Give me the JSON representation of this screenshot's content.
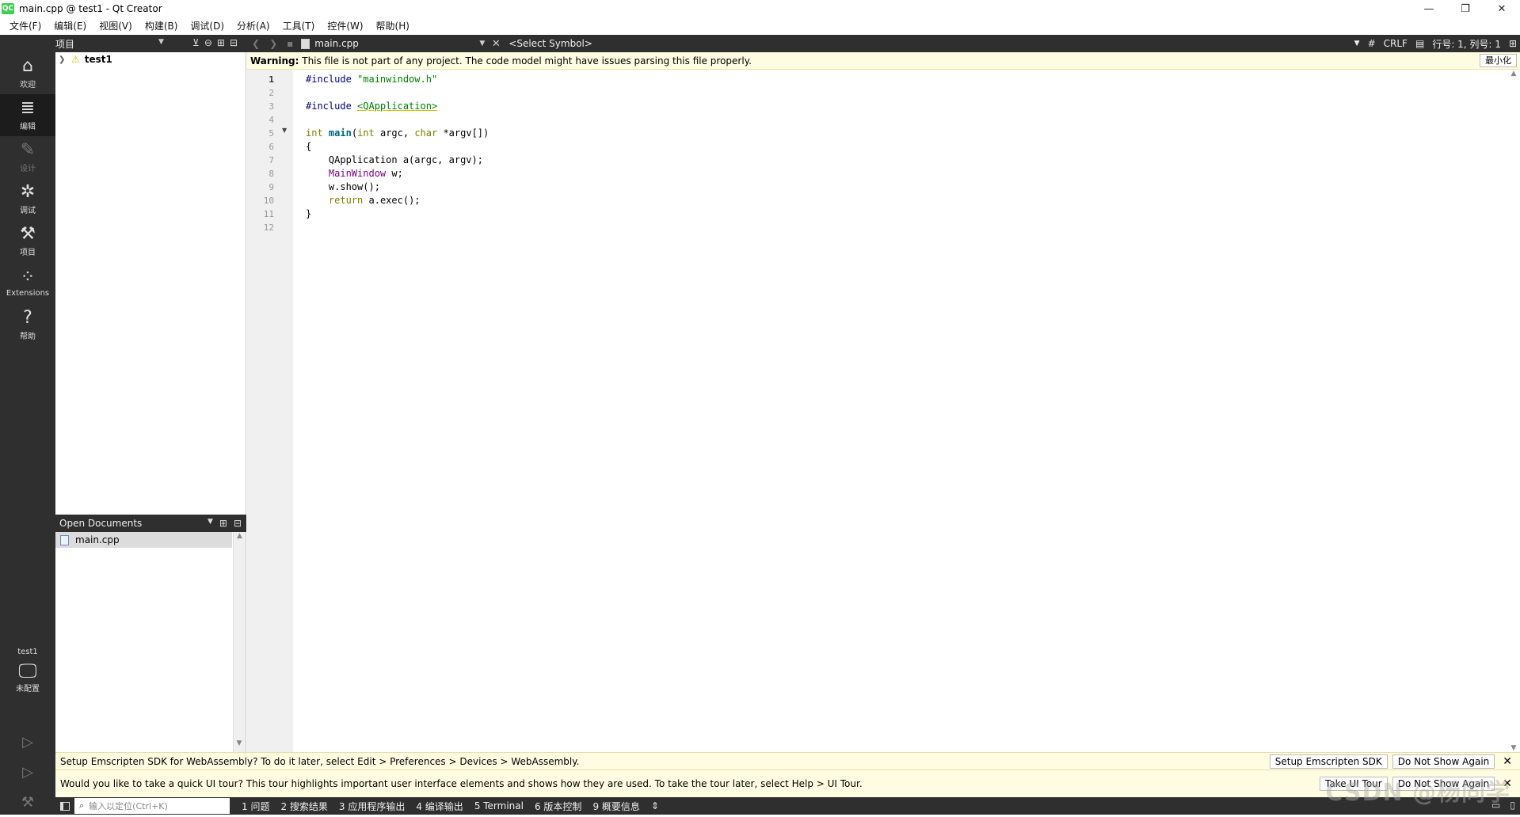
{
  "window": {
    "logo_text": "QC",
    "title": "main.cpp @ test1 - Qt Creator",
    "minimize": "—",
    "restore": "❐",
    "close": "✕"
  },
  "menu": [
    "文件(F)",
    "编辑(E)",
    "视图(V)",
    "构建(B)",
    "调试(D)",
    "分析(A)",
    "工具(T)",
    "控件(W)",
    "帮助(H)"
  ],
  "projects_panel": {
    "title": "项目",
    "tree": [
      {
        "name": "test1",
        "has_warning": true
      }
    ]
  },
  "editor_toolbar": {
    "file": "main.cpp",
    "symbol": "<Select Symbol>",
    "hash": "#",
    "line_ending": "CRLF",
    "position": "行号: 1, 列号: 1"
  },
  "modes": [
    {
      "label": "欢迎",
      "icon": "home-icon",
      "glyph": "⌂"
    },
    {
      "label": "编辑",
      "icon": "edit-icon",
      "glyph": "≣",
      "active": true
    },
    {
      "label": "设计",
      "icon": "design-icon",
      "glyph": "✎",
      "dim": true
    },
    {
      "label": "调试",
      "icon": "debug-icon",
      "glyph": "✲"
    },
    {
      "label": "项目",
      "icon": "wrench-icon",
      "glyph": "⚒"
    },
    {
      "label": "Extensions",
      "icon": "extensions-icon",
      "glyph": "⁘"
    },
    {
      "label": "帮助",
      "icon": "help-icon",
      "glyph": "?"
    }
  ],
  "kit": {
    "name": "test1",
    "config": "未配置"
  },
  "warning_bar": {
    "label": "Warning:",
    "text": " This file is not part of any project. The code model might have issues parsing this file properly.",
    "button": "最小化"
  },
  "code_lines": [
    [
      {
        "t": "#include ",
        "c": "pre"
      },
      {
        "t": "\"mainwindow.h\"",
        "c": "str"
      }
    ],
    [],
    [
      {
        "t": "#include ",
        "c": "pre"
      },
      {
        "t": "<QApplication>",
        "c": "inc"
      }
    ],
    [],
    [
      {
        "t": "int",
        "c": "kw"
      },
      {
        "t": " "
      },
      {
        "t": "main",
        "c": "fn"
      },
      {
        "t": "("
      },
      {
        "t": "int",
        "c": "kw"
      },
      {
        "t": " argc, "
      },
      {
        "t": "char",
        "c": "kw"
      },
      {
        "t": " *argv[])"
      }
    ],
    [
      {
        "t": "{"
      }
    ],
    [
      {
        "t": "    QApplication a(argc, argv);"
      }
    ],
    [
      {
        "t": "    "
      },
      {
        "t": "MainWindow",
        "c": "cls"
      },
      {
        "t": " w;"
      }
    ],
    [
      {
        "t": "    w.show();"
      }
    ],
    [
      {
        "t": "    "
      },
      {
        "t": "return",
        "c": "kw"
      },
      {
        "t": " a.exec();"
      }
    ],
    [
      {
        "t": "}"
      }
    ],
    []
  ],
  "line_numbers": [
    "1",
    "2",
    "3",
    "4",
    "5",
    "6",
    "7",
    "8",
    "9",
    "10",
    "11",
    "12"
  ],
  "open_documents": {
    "title": "Open Documents",
    "items": [
      "main.cpp"
    ]
  },
  "info_bars": [
    {
      "text": "Setup Emscripten SDK for WebAssembly? To do it later, select Edit > Preferences > Devices > WebAssembly.",
      "buttons": [
        "Setup Emscripten SDK",
        "Do Not Show Again"
      ]
    },
    {
      "text": "Would you like to take a quick UI tour? This tour highlights important user interface elements and shows how they are used. To take the tour later, select Help > UI Tour.",
      "buttons": [
        "Take UI Tour",
        "Do Not Show Again"
      ]
    }
  ],
  "status_bar": {
    "locator_placeholder": "输入以定位(Ctrl+K)",
    "panes": [
      "1  问题",
      "2  搜索结果",
      "3  应用程序输出",
      "4  编译输出",
      "5  Terminal",
      "6  版本控制",
      "9  概要信息"
    ]
  },
  "watermark": "CSDN @杨同学"
}
